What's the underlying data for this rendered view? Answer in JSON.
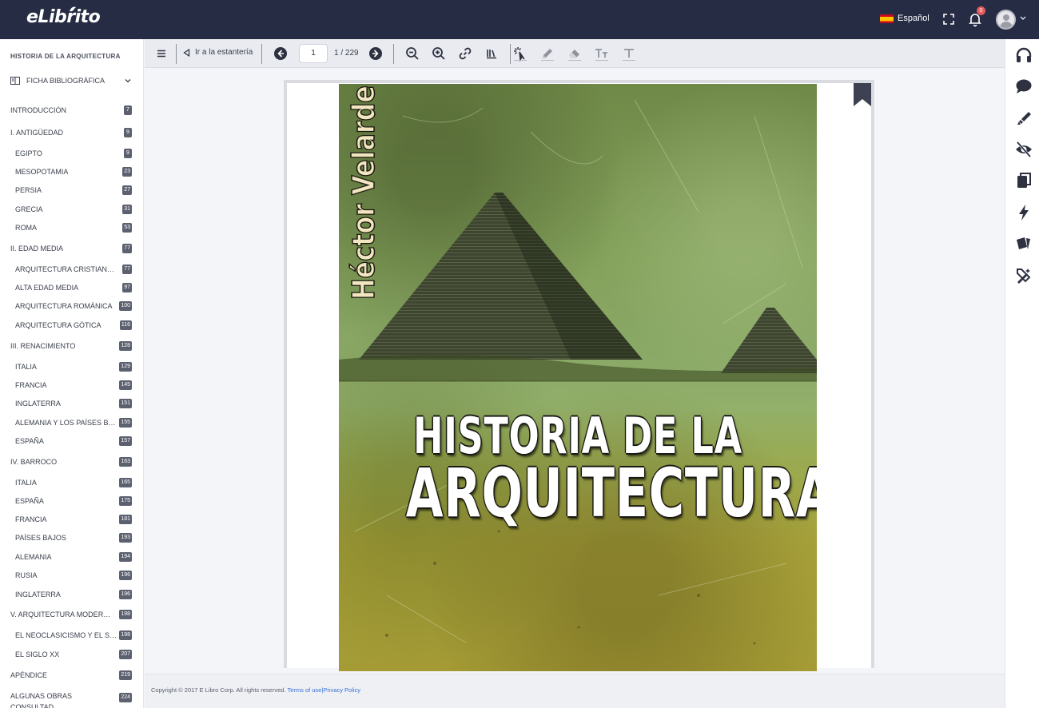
{
  "app": {
    "logo": "eLibrito"
  },
  "header": {
    "language": "Español",
    "notifications_count": "0",
    "icons": [
      "flag-es-icon",
      "fullscreen-icon",
      "bell-icon",
      "avatar-icon",
      "caret-down-icon"
    ]
  },
  "sidebar": {
    "book_title": "HISTORIA DE LA ARQUITECTURA",
    "ficha_label": "FICHA BIBLIOGRÁFICA",
    "toc": [
      {
        "label": "INTRODUCCIÓN",
        "page": "7",
        "level": 0
      },
      {
        "label": "I. ANTIGÜEDAD",
        "page": "9",
        "level": 0
      },
      {
        "label": "EGIPTO",
        "page": "9",
        "level": 1
      },
      {
        "label": "MESOPOTAMIA",
        "page": "23",
        "level": 1
      },
      {
        "label": "PERSIA",
        "page": "27",
        "level": 1
      },
      {
        "label": "GRECIA",
        "page": "31",
        "level": 1
      },
      {
        "label": "ROMA",
        "page": "53",
        "level": 1
      },
      {
        "label": "II. EDAD MEDIA",
        "page": "77",
        "level": 0
      },
      {
        "label": "ARQUITECTURA CRISTIANA …",
        "page": "77",
        "level": 1
      },
      {
        "label": "ALTA EDAD MEDIA",
        "page": "97",
        "level": 1
      },
      {
        "label": "ARQUITECTURA ROMÁNICA",
        "page": "100",
        "level": 1
      },
      {
        "label": "ARQUITECTURA GÓTICA",
        "page": "116",
        "level": 1
      },
      {
        "label": "III. RENACIMIENTO",
        "page": "128",
        "level": 0
      },
      {
        "label": "ITALIA",
        "page": "129",
        "level": 1
      },
      {
        "label": "FRANCIA",
        "page": "145",
        "level": 1
      },
      {
        "label": "INGLATERRA",
        "page": "151",
        "level": 1
      },
      {
        "label": "ALEMANIA Y LOS PAÍSES B…",
        "page": "155",
        "level": 1
      },
      {
        "label": "ESPAÑA",
        "page": "157",
        "level": 1
      },
      {
        "label": "IV. BARROCO",
        "page": "163",
        "level": 0
      },
      {
        "label": "ITALIA",
        "page": "165",
        "level": 1
      },
      {
        "label": "ESPAÑA",
        "page": "175",
        "level": 1
      },
      {
        "label": "FRANCIA",
        "page": "181",
        "level": 1
      },
      {
        "label": "PAÍSES BAJOS",
        "page": "193",
        "level": 1
      },
      {
        "label": "ALEMANIA",
        "page": "194",
        "level": 1
      },
      {
        "label": "RUSIA",
        "page": "196",
        "level": 1
      },
      {
        "label": "INGLATERRA",
        "page": "196",
        "level": 1
      },
      {
        "label": "V. ARQUITECTURA MODERNA",
        "page": "198",
        "level": 0
      },
      {
        "label": "EL NEOCLASICISMO Y EL S…",
        "page": "198",
        "level": 1
      },
      {
        "label": "EL SIGLO XX",
        "page": "207",
        "level": 1
      },
      {
        "label": "APÉNDICE",
        "page": "219",
        "level": 0
      },
      {
        "label": "ALGUNAS OBRAS CONSULTAD…",
        "page": "224",
        "level": 0
      }
    ]
  },
  "toolbar": {
    "back_label": "Ir a la estantería",
    "current_page": "1",
    "total_pages": "1 / 229",
    "icons": [
      "menu-icon",
      "prev-page-icon",
      "next-page-icon",
      "zoom-out-icon",
      "zoom-in-icon",
      "link-icon",
      "library-icon",
      "select-cursor-icon",
      "pencil-icon",
      "eraser-icon",
      "text-size-icon",
      "text-icon"
    ]
  },
  "book": {
    "author": "Héctor Velarde",
    "title_line1": "HISTORIA DE LA",
    "title_line2": "ARQUITECTURA"
  },
  "footer": {
    "copyright": "Copyright © 2017 E Libro Corp. All rights reserved.",
    "terms": "Terms of use",
    "separator": "|",
    "privacy": "Privacy Policy"
  },
  "right_rail": {
    "icons": [
      "headphones-icon",
      "comment-icon",
      "highlighter-icon",
      "eye-slash-icon",
      "copy-icon",
      "bolt-icon",
      "cards-icon",
      "magic-tools-icon"
    ]
  },
  "colors": {
    "topbar": "#262c44",
    "accent_link": "#3a6fd8",
    "badge": "#5c6170",
    "notification": "#e45c5c"
  }
}
